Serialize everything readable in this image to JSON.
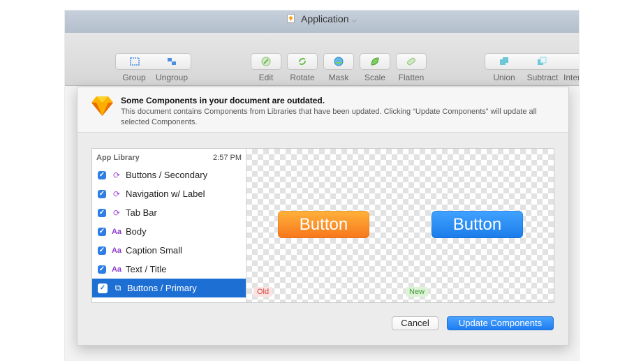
{
  "window": {
    "title": "Application"
  },
  "toolbar": {
    "group": "Group",
    "ungroup": "Ungroup",
    "edit": "Edit",
    "rotate": "Rotate",
    "mask": "Mask",
    "scale": "Scale",
    "flatten": "Flatten",
    "union": "Union",
    "subtract": "Subtract",
    "intersect": "Inter"
  },
  "sheet": {
    "heading": "Some Components in your document are outdated.",
    "description": "This document contains Components from Libraries that have been updated. Clicking “Update Components” will update all selected Components.",
    "library": {
      "name": "App Library",
      "time": "2:57 PM"
    },
    "items": [
      {
        "label": "Buttons / Secondary",
        "icon": "symbol-icon",
        "checked": true
      },
      {
        "label": "Navigation w/ Label",
        "icon": "symbol-icon",
        "checked": true
      },
      {
        "label": "Tab Bar",
        "icon": "symbol-icon",
        "checked": true
      },
      {
        "label": "Body",
        "icon": "text-style-icon",
        "checked": true
      },
      {
        "label": "Caption Small",
        "icon": "text-style-icon",
        "checked": true
      },
      {
        "label": "Text / Title",
        "icon": "text-style-icon",
        "checked": true
      },
      {
        "label": "Buttons / Primary",
        "icon": "symbol-instance-icon",
        "checked": true,
        "selected": true
      }
    ],
    "preview": {
      "old_button": "Button",
      "new_button": "Button",
      "old_tag": "Old",
      "new_tag": "New"
    },
    "buttons": {
      "cancel": "Cancel",
      "update": "Update Components"
    }
  },
  "colors": {
    "accent": "#1f7cf0",
    "old_button": "#f7761c",
    "new_button": "#1b7bea",
    "selection": "#1e6fd4"
  },
  "glyphs": {
    "check": "✓",
    "sym": "⟳",
    "inst": "⧉",
    "aa": "Aa"
  }
}
